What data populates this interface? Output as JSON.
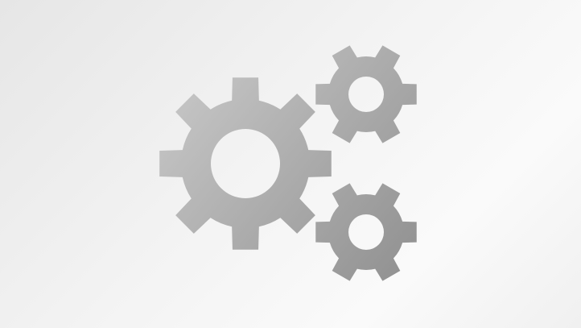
{
  "illustration": {
    "icon": "gears-icon",
    "gears": [
      {
        "name": "large-gear-icon",
        "teeth": 8
      },
      {
        "name": "small-gear-top-icon",
        "teeth": 6
      },
      {
        "name": "small-gear-bottom-icon",
        "teeth": 6
      }
    ],
    "colors": {
      "background_light": "#fafafa",
      "background_dark": "#e6e6e6",
      "gear_light": "#c9c9c9",
      "gear_dark": "#8f8f8f"
    }
  }
}
